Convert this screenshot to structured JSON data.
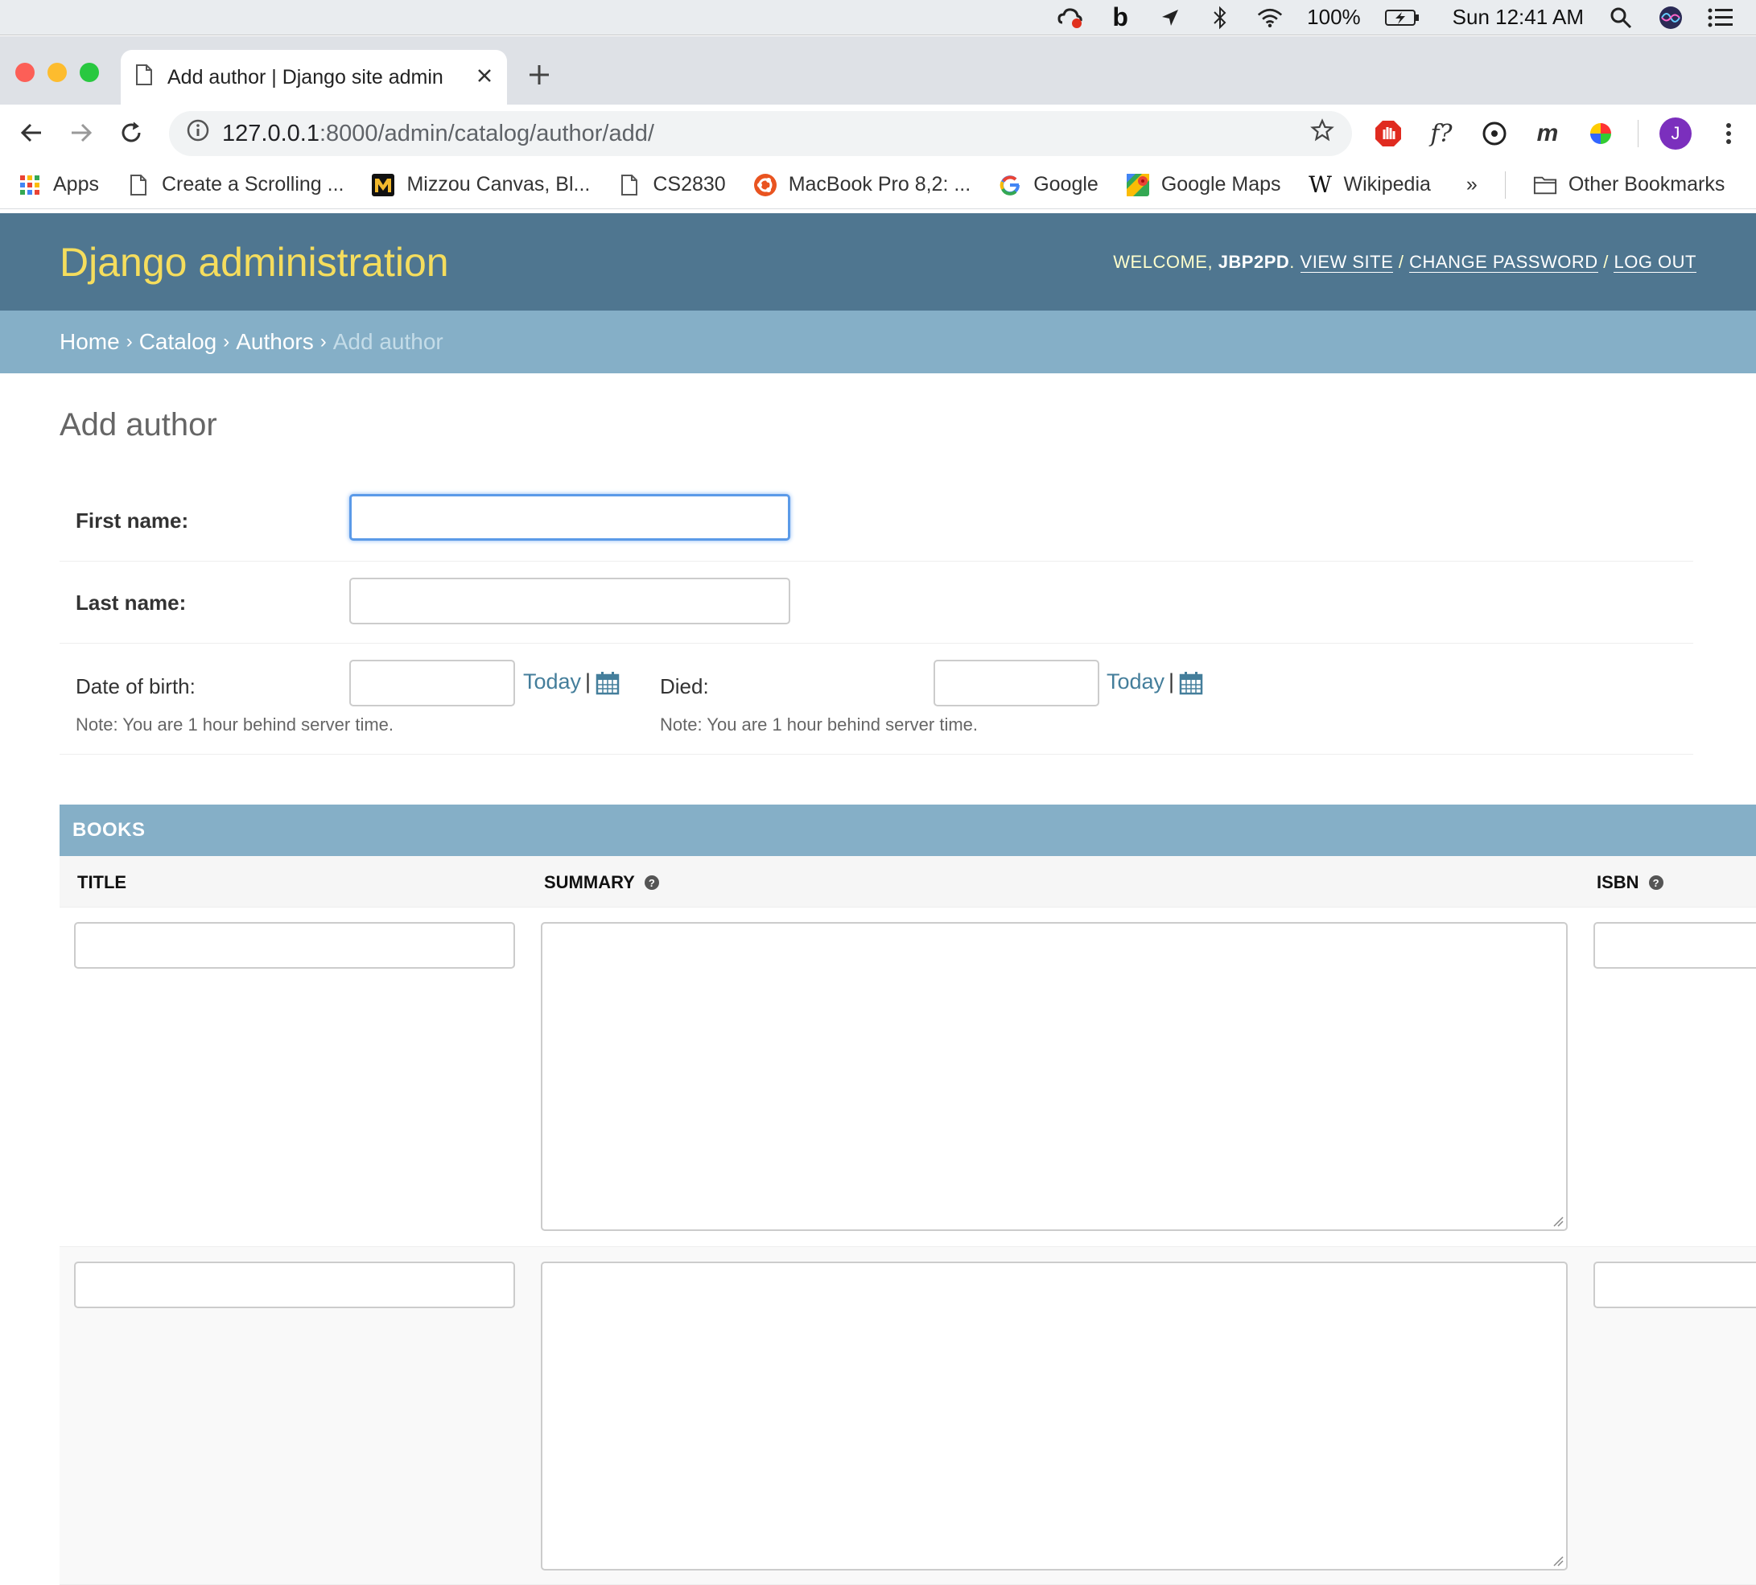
{
  "menubar": {
    "battery": "100%",
    "clock": "Sun 12:41 AM"
  },
  "browser": {
    "tab_title": "Add author | Django site admin",
    "url_host": "127.0.0.1",
    "url_path": ":8000/admin/catalog/author/add/",
    "profile_initial": "J",
    "bookmarks": [
      {
        "label": "Apps",
        "icon": "apps-grid-icon"
      },
      {
        "label": "Create a Scrolling ...",
        "icon": "page-icon"
      },
      {
        "label": "Mizzou Canvas, Bl...",
        "icon": "mizzou-icon"
      },
      {
        "label": "CS2830",
        "icon": "page-icon"
      },
      {
        "label": "MacBook Pro 8,2: ...",
        "icon": "ubuntu-icon"
      },
      {
        "label": "Google",
        "icon": "google-icon"
      },
      {
        "label": "Google Maps",
        "icon": "maps-icon"
      },
      {
        "label": "Wikipedia",
        "icon": "wikipedia-icon"
      }
    ],
    "more_bookmarks": "»",
    "other_bookmarks": "Other Bookmarks"
  },
  "header": {
    "branding": "Django administration",
    "welcome": "WELCOME,",
    "username": "JBP2PD",
    "view_site": "VIEW SITE",
    "change_password": "CHANGE PASSWORD",
    "log_out": "LOG OUT",
    "sep": "/"
  },
  "breadcrumbs": {
    "home": "Home",
    "catalog": "Catalog",
    "authors": "Authors",
    "current": "Add author",
    "sep": "›"
  },
  "form": {
    "title": "Add author",
    "first_name_label": "First name:",
    "first_name_value": "",
    "last_name_label": "Last name:",
    "last_name_value": "",
    "dob_label": "Date of birth:",
    "died_label": "Died:",
    "today": "Today",
    "pipe": "|",
    "server_note": "Note: You are 1 hour behind server time."
  },
  "books": {
    "caption": "BOOKS",
    "columns": [
      {
        "label": "TITLE",
        "help": false
      },
      {
        "label": "SUMMARY",
        "help": true
      },
      {
        "label": "ISBN",
        "help": true
      }
    ],
    "help_glyph": "?"
  },
  "colors": {
    "header_bg": "#4f7690",
    "branding": "#f5dd5d",
    "breadcrumb_bg": "#85afc7",
    "link": "#447e9b"
  }
}
